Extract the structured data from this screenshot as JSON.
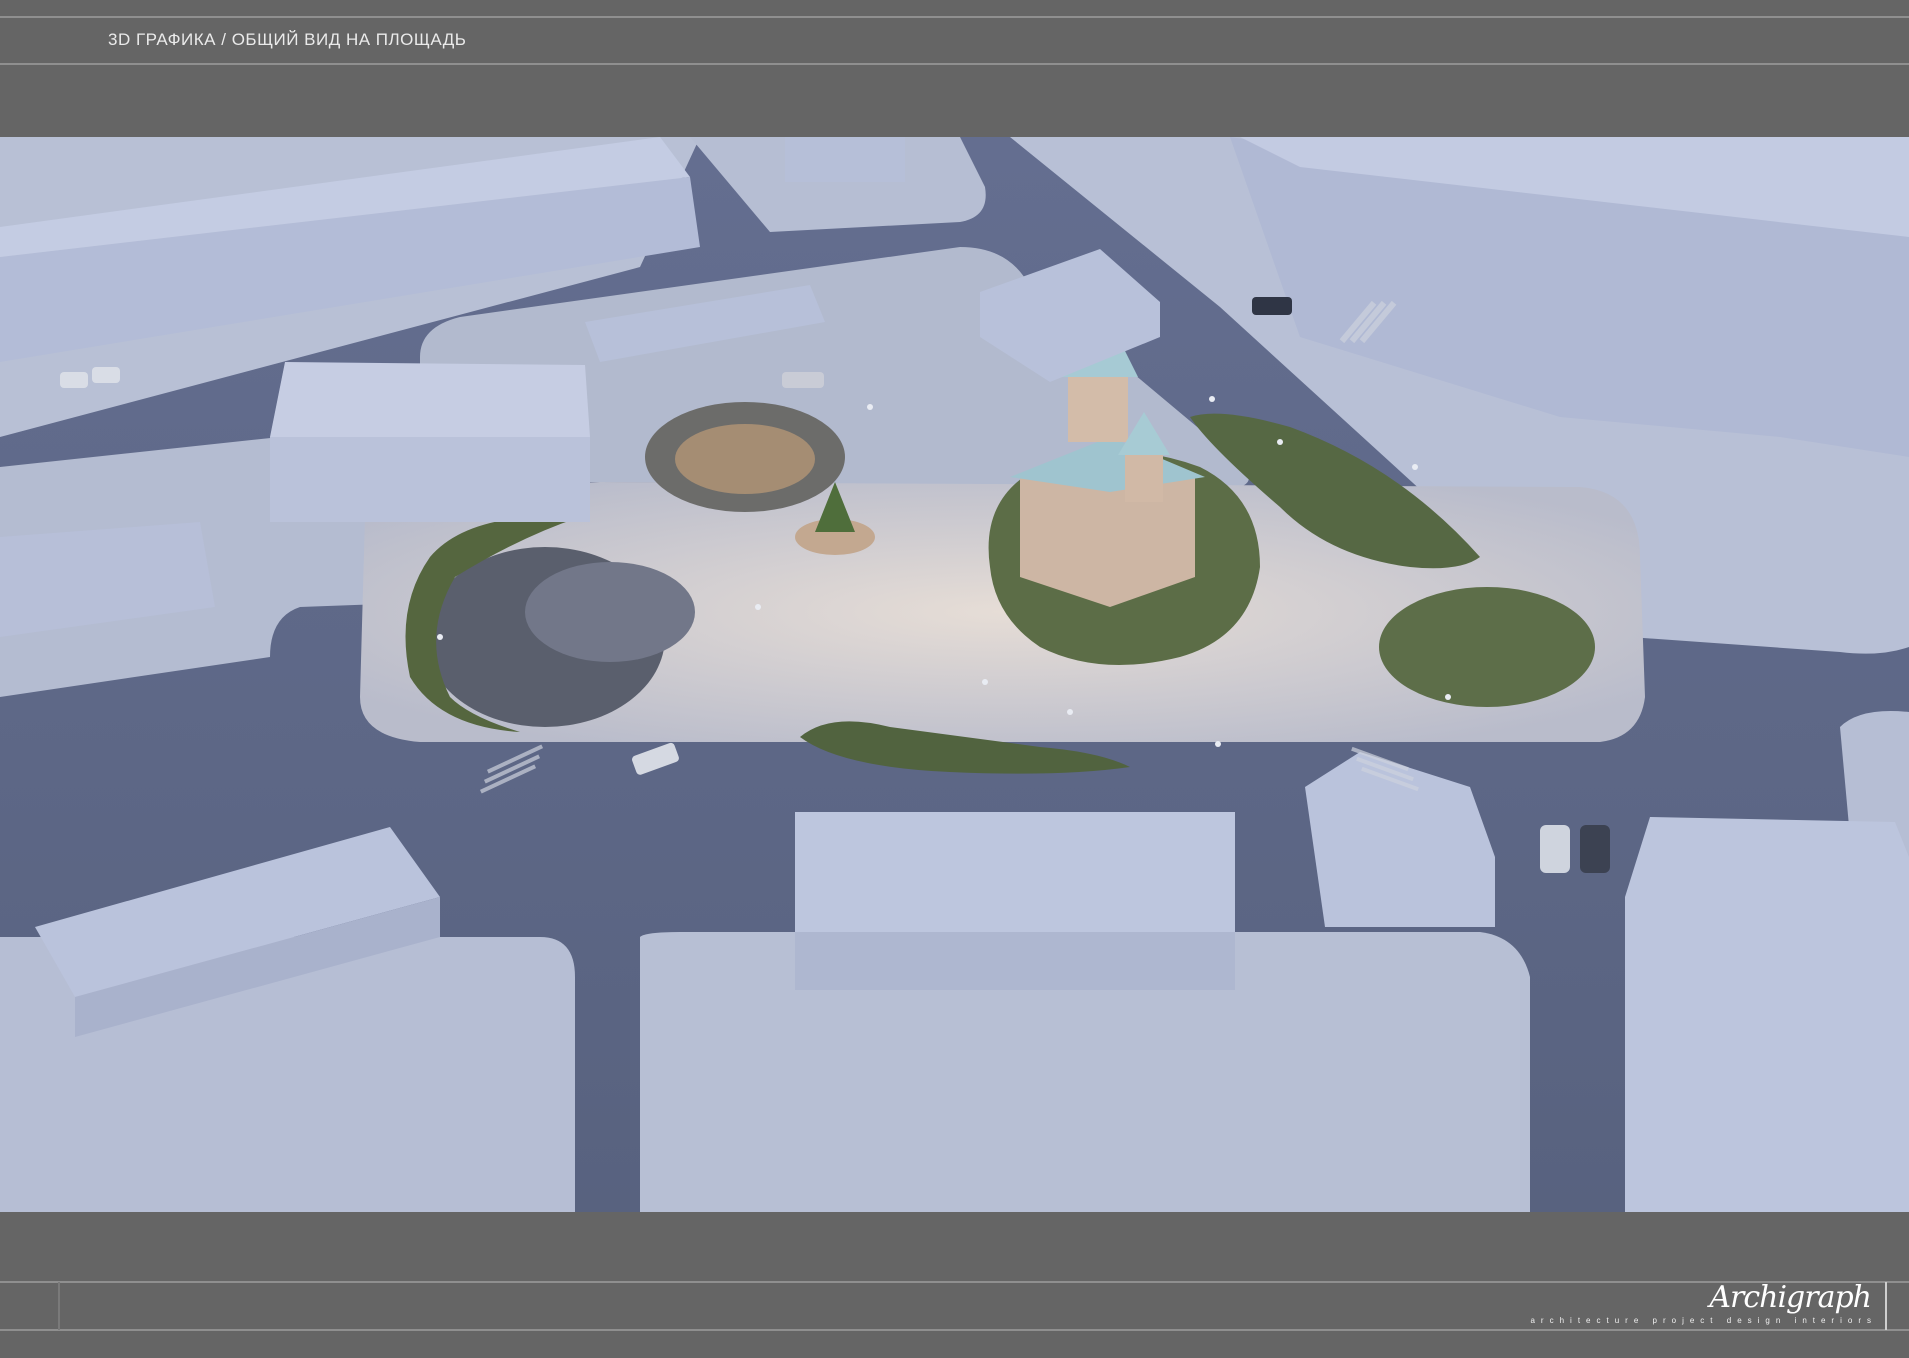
{
  "header": {
    "title": "3D ГРАФИКА / ОБЩИЙ ВИД НА ПЛОЩАДЬ"
  },
  "render": {
    "icon": "aerial-3d-render-image"
  },
  "branding": {
    "logo_text": "Archigraph",
    "tagline": "architecture project design interiors"
  },
  "colors": {
    "frame": "#656565",
    "rule": "#8f8f8f",
    "road": "#5d6787",
    "snow": "#b9c1d6",
    "building": "#b4bdd6",
    "plaza": "#d6d2d0",
    "greenery": "#5a6a4a",
    "church_roof": "#9fc6cf"
  }
}
